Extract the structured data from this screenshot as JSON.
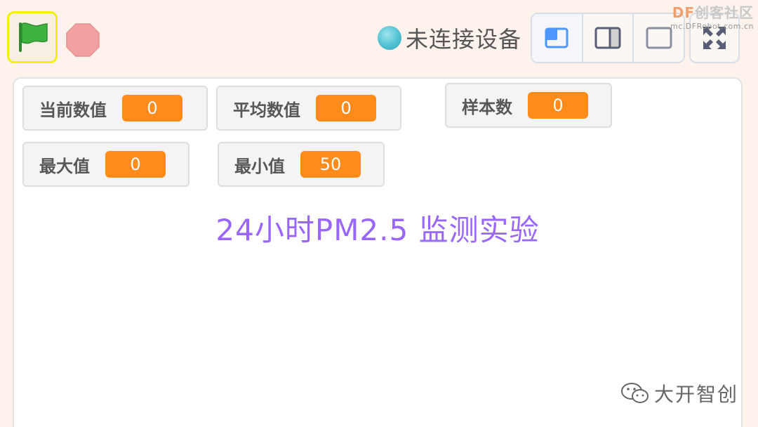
{
  "toolbar": {
    "connection_status": "未连接设备",
    "green_flag_icon": "green-flag-icon",
    "stop_icon": "stop-icon",
    "layout_buttons": [
      "small-stage-icon",
      "large-stage-icon",
      "stage-only-icon"
    ],
    "fullscreen_icon": "fullscreen-icon"
  },
  "watermark_top": {
    "brand_prefix": "DF",
    "brand_name": "创客社区",
    "url": "mc.DFRobot.com.cn"
  },
  "stage": {
    "monitors": [
      {
        "label": "当前数值",
        "value": "0"
      },
      {
        "label": "平均数值",
        "value": "0"
      },
      {
        "label": "样本数",
        "value": "0"
      },
      {
        "label": "最大值",
        "value": "0"
      },
      {
        "label": "最小值",
        "value": "50"
      }
    ],
    "title": "24小时PM2.5 监测实验"
  },
  "watermark_bottom": {
    "text": "大开智创"
  },
  "colors": {
    "accent_orange": "#ff8c1a",
    "title_purple": "#9966ff",
    "flag_green": "#3fb33f",
    "stop_red": "#f2a0a0",
    "selected_blue": "#4c97ff"
  }
}
